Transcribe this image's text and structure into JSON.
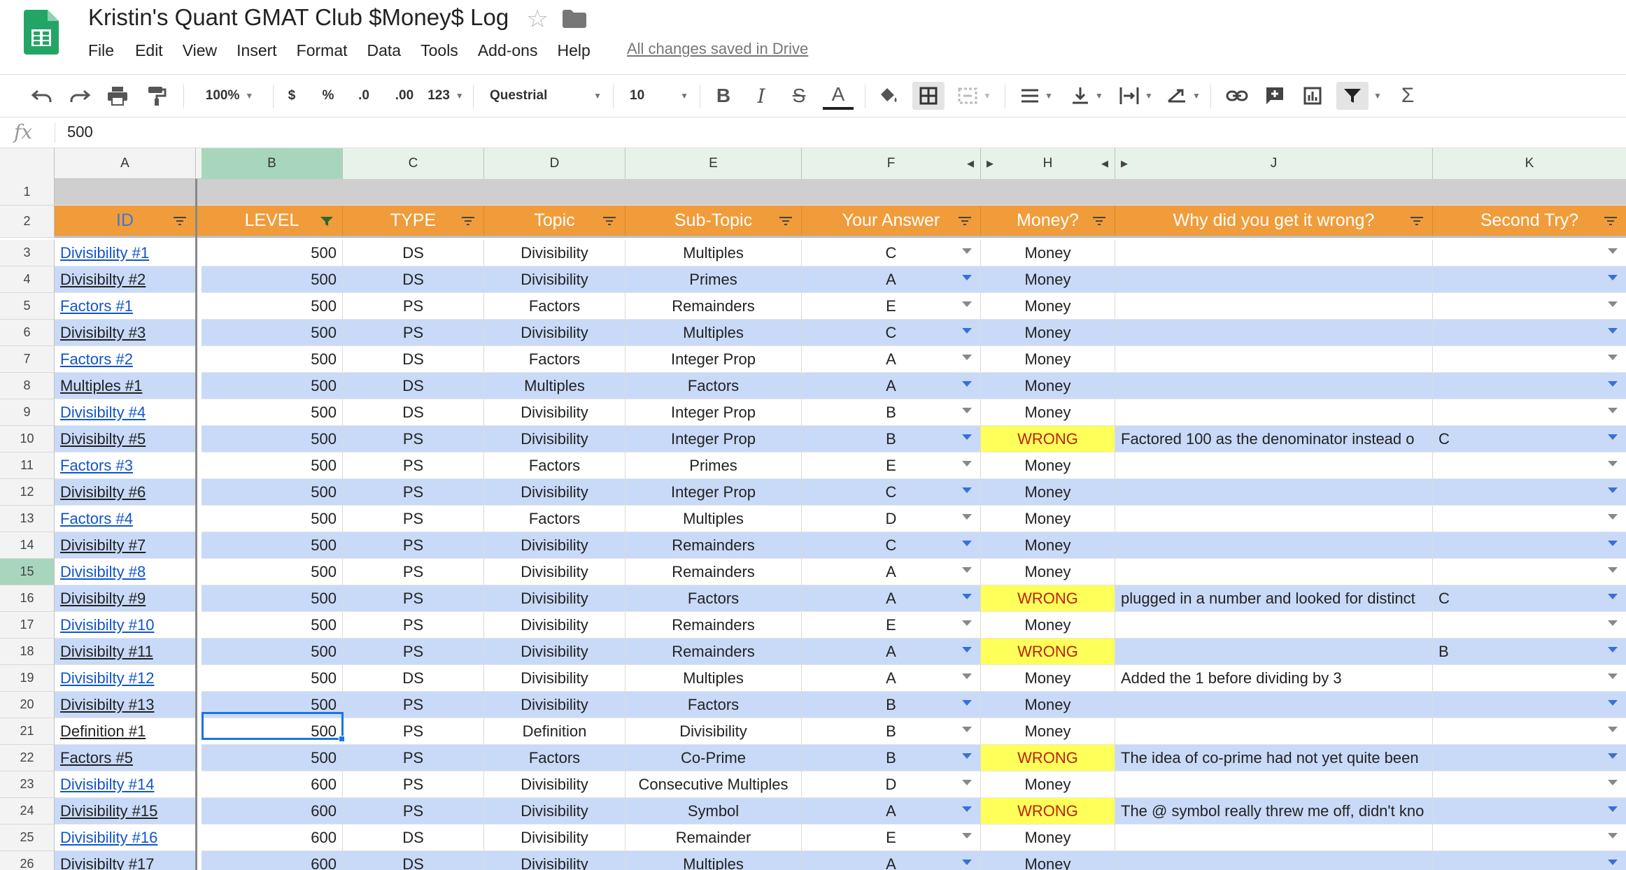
{
  "title_bar": {
    "doc_title": "Kristin's Quant GMAT Club $Money$ Log",
    "save_status": "All changes saved in Drive",
    "menu": [
      "File",
      "Edit",
      "View",
      "Insert",
      "Format",
      "Data",
      "Tools",
      "Add-ons",
      "Help"
    ]
  },
  "toolbar": {
    "zoom": "100%",
    "currency": "$",
    "percent": "%",
    "decrease_decimal": ".0",
    "increase_decimal": ".00",
    "more_formats": "123",
    "font": "Questrial",
    "font_size": "10",
    "bold": "B",
    "italic": "I",
    "strike": "S",
    "text_color": "A",
    "sum": "Σ"
  },
  "formula_bar": {
    "fx": "fx",
    "value": "500"
  },
  "columns": [
    "A",
    "B",
    "C",
    "D",
    "E",
    "F",
    "H",
    "J",
    "K"
  ],
  "header_row": {
    "id": "ID",
    "level": "LEVEL",
    "type": "TYPE",
    "topic": "Topic",
    "subtopic": "Sub-Topic",
    "answer": "Your Answer",
    "money": "Money?",
    "why": "Why did you get it wrong?",
    "second": "Second Try?"
  },
  "row_numbers": [
    "1",
    "2",
    "3",
    "4",
    "5",
    "6",
    "7",
    "8",
    "9",
    "10",
    "11",
    "12",
    "13",
    "14",
    "15",
    "16",
    "17",
    "18",
    "19",
    "20",
    "21",
    "22",
    "23",
    "24",
    "25",
    "26"
  ],
  "rows": [
    {
      "id": "Divisibility #1",
      "link": true,
      "level": "500",
      "type": "DS",
      "topic": "Divisibility",
      "subtopic": "Multiples",
      "answer": "C",
      "money": "Money",
      "why": "",
      "second": ""
    },
    {
      "id": "Divisibilty #2",
      "link": false,
      "level": "500",
      "type": "DS",
      "topic": "Divisibility",
      "subtopic": "Primes",
      "answer": "A",
      "money": "Money",
      "why": "",
      "second": ""
    },
    {
      "id": "Factors #1",
      "link": true,
      "level": "500",
      "type": "PS",
      "topic": "Factors",
      "subtopic": "Remainders",
      "answer": "E",
      "money": "Money",
      "why": "",
      "second": ""
    },
    {
      "id": "Divisibilty #3",
      "link": false,
      "level": "500",
      "type": "PS",
      "topic": "Divisibility",
      "subtopic": "Multiples",
      "answer": "C",
      "money": "Money",
      "why": "",
      "second": ""
    },
    {
      "id": "Factors #2",
      "link": true,
      "level": "500",
      "type": "DS",
      "topic": "Factors",
      "subtopic": "Integer Prop",
      "answer": "A",
      "money": "Money",
      "why": "",
      "second": ""
    },
    {
      "id": "Multiples #1",
      "link": false,
      "level": "500",
      "type": "DS",
      "topic": "Multiples",
      "subtopic": "Factors",
      "answer": "A",
      "money": "Money",
      "why": "",
      "second": ""
    },
    {
      "id": "Divisibilty #4",
      "link": true,
      "level": "500",
      "type": "DS",
      "topic": "Divisibility",
      "subtopic": "Integer Prop",
      "answer": "B",
      "money": "Money",
      "why": "",
      "second": ""
    },
    {
      "id": "Divisibilty #5",
      "link": false,
      "level": "500",
      "type": "PS",
      "topic": "Divisibility",
      "subtopic": "Integer Prop",
      "answer": "B",
      "money": "WRONG",
      "why": "Factored 100 as the denominator instead o",
      "second": "C"
    },
    {
      "id": "Factors #3",
      "link": true,
      "level": "500",
      "type": "PS",
      "topic": "Factors",
      "subtopic": "Primes",
      "answer": "E",
      "money": "Money",
      "why": "",
      "second": ""
    },
    {
      "id": "Divisibilty #6",
      "link": false,
      "level": "500",
      "type": "PS",
      "topic": "Divisibility",
      "subtopic": "Integer Prop",
      "answer": "C",
      "money": "Money",
      "why": "",
      "second": ""
    },
    {
      "id": "Factors #4",
      "link": true,
      "level": "500",
      "type": "PS",
      "topic": "Factors",
      "subtopic": "Multiples",
      "answer": "D",
      "money": "Money",
      "why": "",
      "second": ""
    },
    {
      "id": "Divisibilty #7",
      "link": false,
      "level": "500",
      "type": "PS",
      "topic": "Divisibility",
      "subtopic": "Remainders",
      "answer": "C",
      "money": "Money",
      "why": "",
      "second": ""
    },
    {
      "id": "Divisibilty #8",
      "link": true,
      "level": "500",
      "type": "PS",
      "topic": "Divisibility",
      "subtopic": "Remainders",
      "answer": "A",
      "money": "Money",
      "why": "",
      "second": ""
    },
    {
      "id": "Divisibilty #9",
      "link": false,
      "level": "500",
      "type": "PS",
      "topic": "Divisibility",
      "subtopic": "Factors",
      "answer": "A",
      "money": "WRONG",
      "why": "plugged in a number and looked for distinct",
      "second": "C"
    },
    {
      "id": "Divisibilty #10",
      "link": true,
      "level": "500",
      "type": "PS",
      "topic": "Divisibility",
      "subtopic": "Remainders",
      "answer": "E",
      "money": "Money",
      "why": "",
      "second": ""
    },
    {
      "id": "Divisibilty #11",
      "link": false,
      "level": "500",
      "type": "PS",
      "topic": "Divisibility",
      "subtopic": "Remainders",
      "answer": "A",
      "money": "WRONG",
      "why": "",
      "second": "B"
    },
    {
      "id": "Divisibilty #12",
      "link": true,
      "level": "500",
      "type": "DS",
      "topic": "Divisibility",
      "subtopic": "Multiples",
      "answer": "A",
      "money": "Money",
      "why": "Added the 1 before dividing by 3",
      "second": ""
    },
    {
      "id": "Divisibilty #13",
      "link": false,
      "level": "500",
      "type": "PS",
      "topic": "Divisibility",
      "subtopic": "Factors",
      "answer": "B",
      "money": "Money",
      "why": "",
      "second": ""
    },
    {
      "id": "Definition #1",
      "link": false,
      "level": "500",
      "type": "PS",
      "topic": "Definition",
      "subtopic": "Divisibility",
      "answer": "B",
      "money": "Money",
      "why": "",
      "second": ""
    },
    {
      "id": "Factors #5",
      "link": false,
      "level": "500",
      "type": "PS",
      "topic": "Factors",
      "subtopic": "Co-Prime",
      "answer": "B",
      "money": "WRONG",
      "why": "The idea of co-prime had not yet quite been",
      "second": ""
    },
    {
      "id": "Divisibilty #14",
      "link": true,
      "level": "600",
      "type": "PS",
      "topic": "Divisibility",
      "subtopic": "Consecutive Multiples",
      "answer": "D",
      "money": "Money",
      "why": "",
      "second": ""
    },
    {
      "id": "Divisibility #15",
      "link": false,
      "level": "600",
      "type": "PS",
      "topic": "Divisibility",
      "subtopic": "Symbol",
      "answer": "A",
      "money": "WRONG",
      "why": "The @ symbol really threw me off, didn't kno",
      "second": ""
    },
    {
      "id": "Divisibility #16",
      "link": true,
      "level": "600",
      "type": "DS",
      "topic": "Divisibility",
      "subtopic": "Remainder",
      "answer": "E",
      "money": "Money",
      "why": "",
      "second": ""
    },
    {
      "id": "Divisibilty #17",
      "link": false,
      "level": "600",
      "type": "DS",
      "topic": "Divisibility",
      "subtopic": "Multiples",
      "answer": "A",
      "money": "Money",
      "why": "",
      "second": ""
    }
  ],
  "colors": {
    "header_orange": "#f09c3a",
    "band_blue": "#c9daf8",
    "wrong_yellow": "#ffff5a",
    "link_blue": "#1155cc",
    "sheets_green": "#23a566"
  }
}
